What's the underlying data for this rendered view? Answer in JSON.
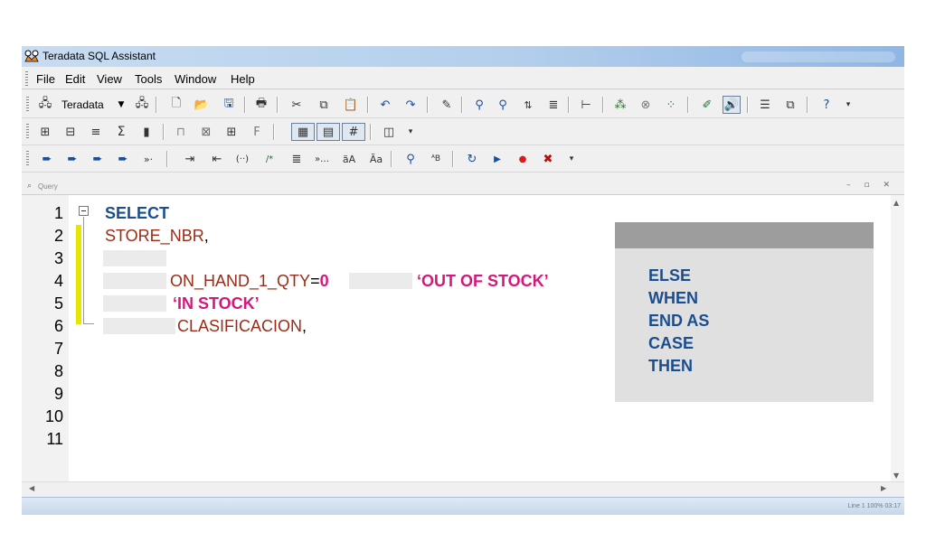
{
  "window": {
    "title": "Teradata SQL Assistant",
    "accent": "#b4cfec"
  },
  "menu": [
    "File",
    "Edit",
    "View",
    "Tools",
    "Window",
    "Help"
  ],
  "toolbar1": {
    "datasource": "Teradata",
    "icons": [
      "connect-icon",
      "dropdown-icon",
      "disconnect-icon",
      "new-icon",
      "open-icon",
      "save-icon",
      "print-icon",
      "cut-icon",
      "copy-icon",
      "paste-icon",
      "undo-icon",
      "redo-icon",
      "edit-icon",
      "find-icon",
      "find-next-icon",
      "sort-icon",
      "format-icon",
      "tree-icon",
      "execute-parallel-icon",
      "abort-icon",
      "explain-icon",
      "pencil-icon",
      "sound-icon",
      "layout-icon",
      "window-icon",
      "help-icon"
    ]
  },
  "query_pane": {
    "label": "Query"
  },
  "editor": {
    "line_numbers": [
      "1",
      "2",
      "3",
      "4",
      "5",
      "6",
      "7",
      "8",
      "9",
      "10",
      "11"
    ],
    "line1": {
      "keyword": "SELECT"
    },
    "line2": {
      "ident": "STORE_NBR",
      "punct": ","
    },
    "line4": {
      "ident": "ON_HAND_1_QTY",
      "op": "=",
      "number": "0",
      "string": "‘OUT OF STOCK’"
    },
    "line5": {
      "string": "‘IN STOCK’"
    },
    "line6": {
      "ident": "CLASIFICACION",
      "punct": ","
    }
  },
  "answer_options": [
    "ELSE",
    "WHEN",
    "END AS",
    "CASE",
    "THEN"
  ],
  "status": {
    "text": "Line 1  100%  03:17"
  },
  "colors": {
    "keyword": "#1a4e8f",
    "identifier": "#9b2b17",
    "string": "#d4187a",
    "change_bar": "#e6e600"
  }
}
